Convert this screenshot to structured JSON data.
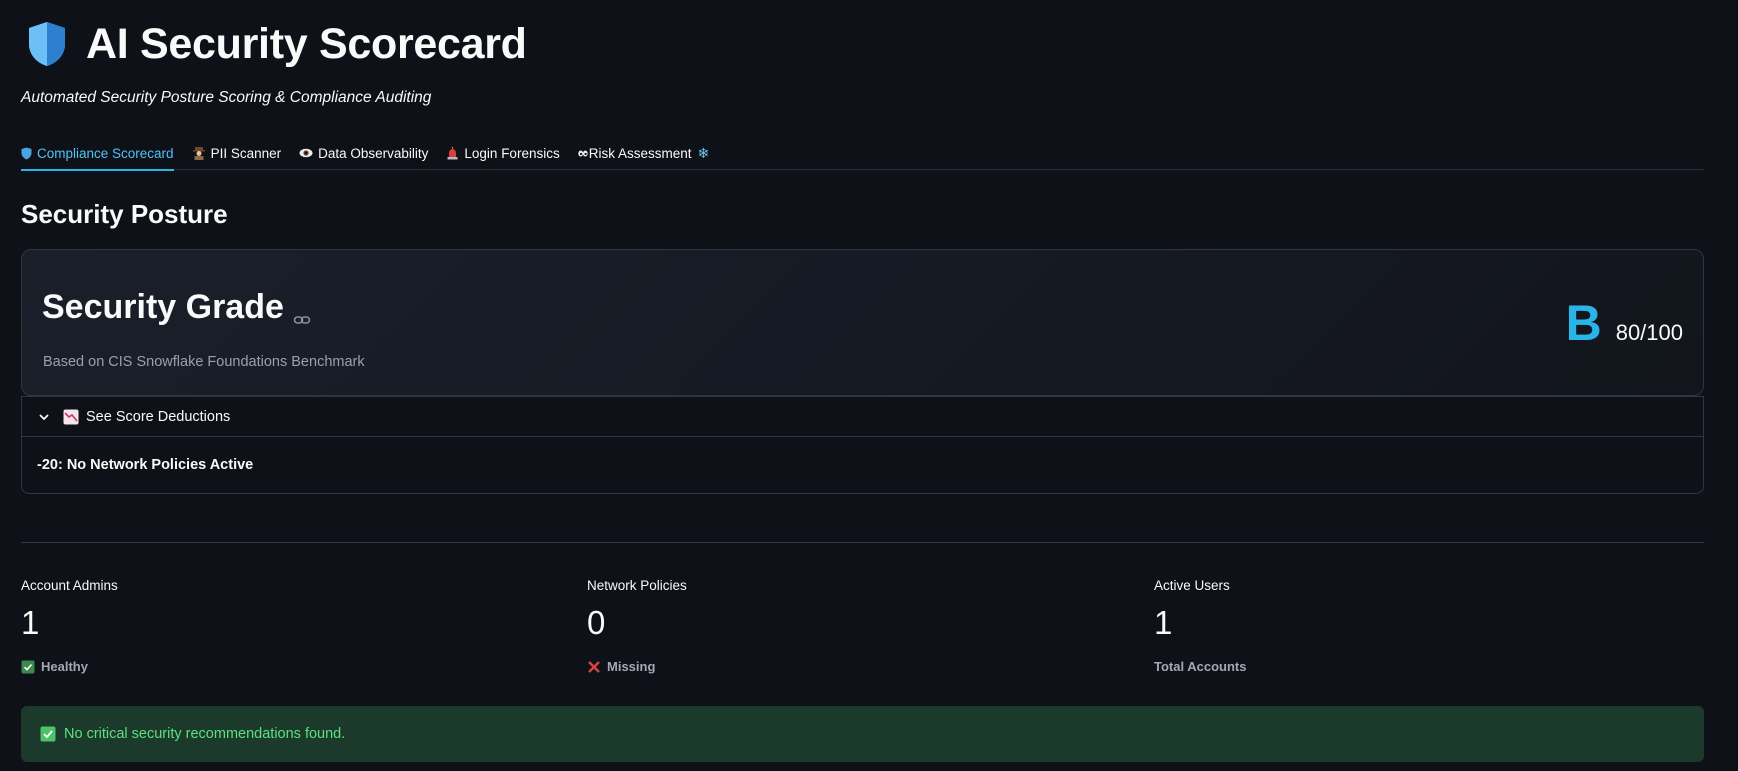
{
  "app": {
    "title": "AI Security Scorecard",
    "subtitle": "Automated Security Posture Scoring & Compliance Auditing"
  },
  "tabs": [
    {
      "label": "Compliance Scorecard",
      "icon": "shield-icon",
      "active": true
    },
    {
      "label": "PII Scanner",
      "icon": "detective-icon",
      "active": false
    },
    {
      "label": "Data Observability",
      "icon": "eye-icon",
      "active": false
    },
    {
      "label": "Login Forensics",
      "icon": "siren-icon",
      "active": false
    },
    {
      "label": "Risk Assessment",
      "icon": "eyes-icon",
      "trailing_icon": "snowflake-icon",
      "active": false
    }
  ],
  "section": {
    "title": "Security Posture"
  },
  "grade_card": {
    "title": "Security Grade",
    "subtitle": "Based on CIS Snowflake Foundations Benchmark",
    "grade": "B",
    "score": "80/100"
  },
  "expander": {
    "label": "See Score Deductions",
    "items": [
      "-20: No Network Policies Active"
    ]
  },
  "metrics": [
    {
      "label": "Account Admins",
      "value": "1",
      "delta": "Healthy",
      "delta_icon": "check-box-icon"
    },
    {
      "label": "Network Policies",
      "value": "0",
      "delta": "Missing",
      "delta_icon": "cross-icon"
    },
    {
      "label": "Active Users",
      "value": "1",
      "delta": "Total Accounts",
      "delta_icon": ""
    }
  ],
  "alert": {
    "message": "No critical security recommendations found."
  },
  "colors": {
    "background": "#0e1117",
    "accent": "#29b5e8",
    "success_bg": "#1b3a2b",
    "success_text": "#5fe07f"
  }
}
